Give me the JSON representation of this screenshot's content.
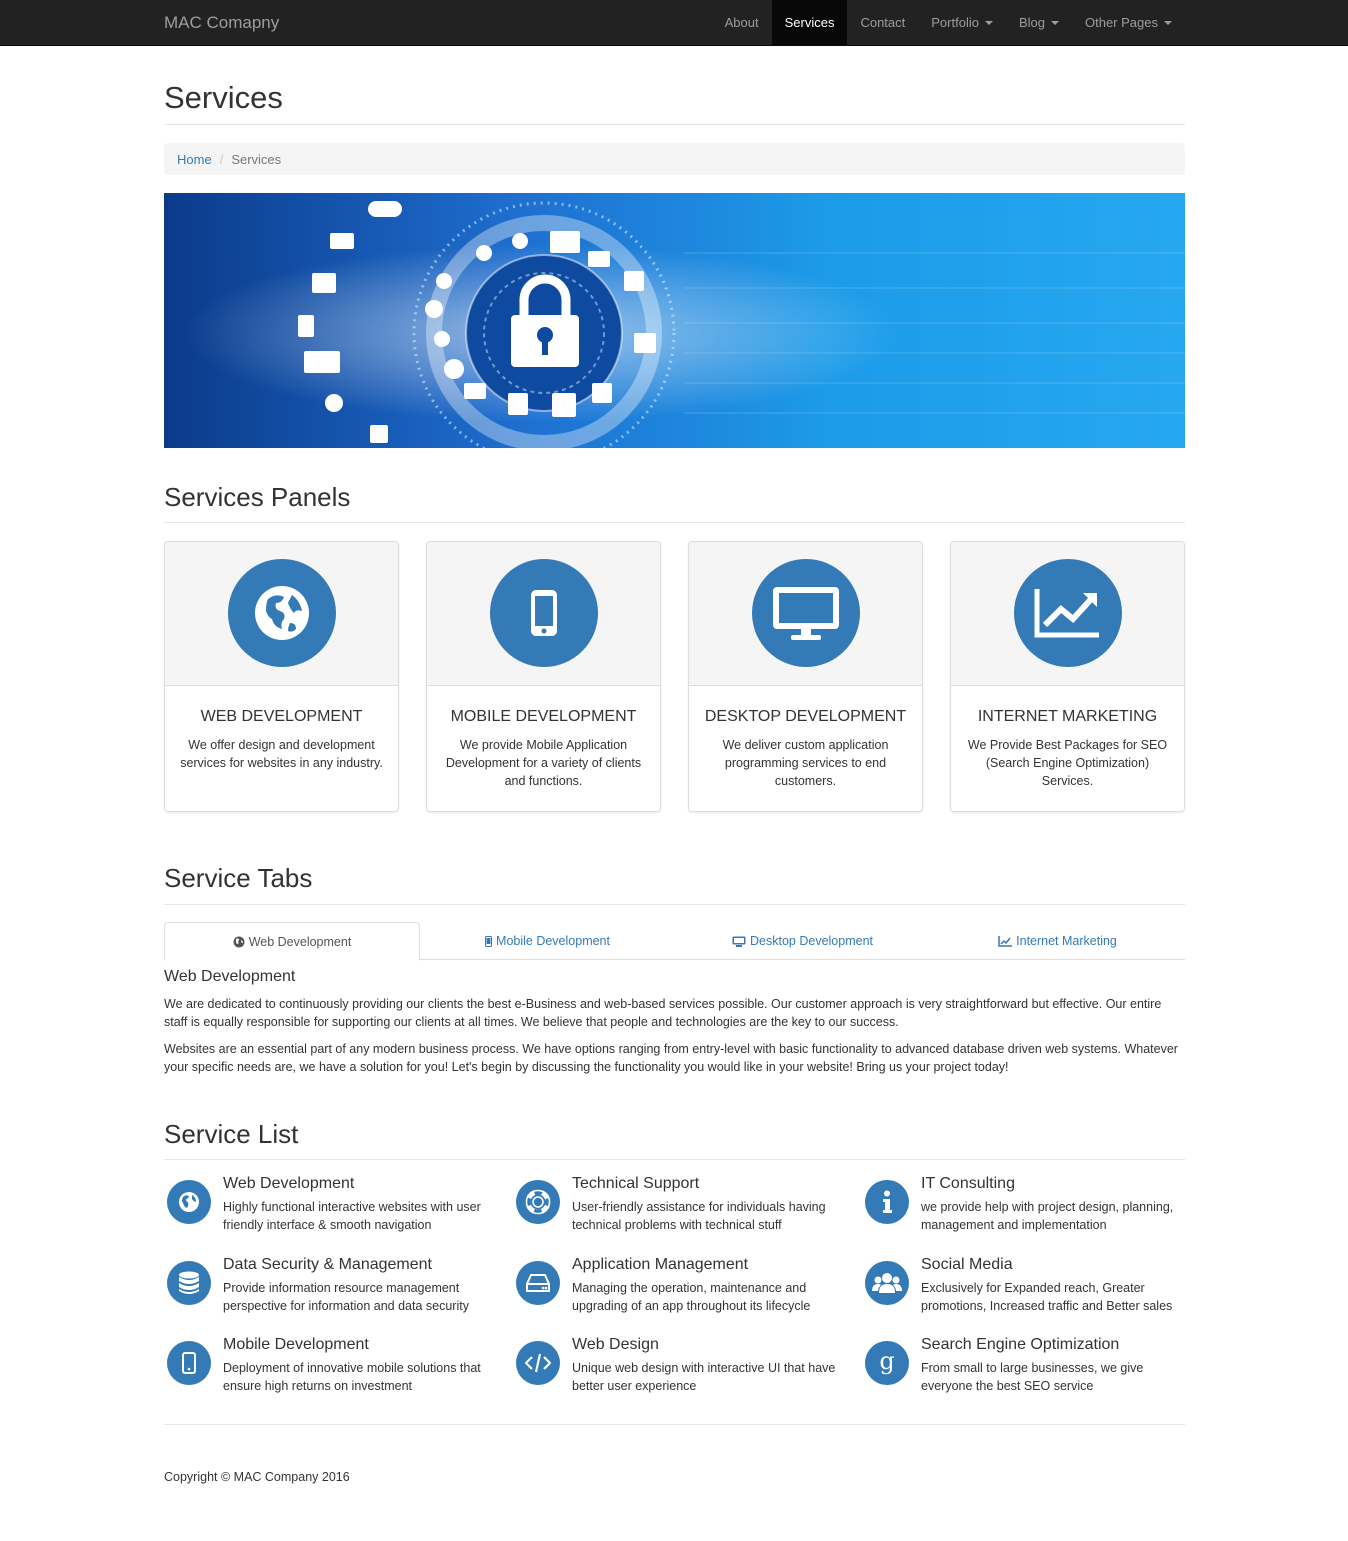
{
  "navbar": {
    "brand": "MAC Comapny",
    "items": [
      {
        "label": "About",
        "dropdown": false,
        "active": false
      },
      {
        "label": "Services",
        "dropdown": false,
        "active": true
      },
      {
        "label": "Contact",
        "dropdown": false,
        "active": false
      },
      {
        "label": "Portfolio",
        "dropdown": true,
        "active": false
      },
      {
        "label": "Blog",
        "dropdown": true,
        "active": false
      },
      {
        "label": "Other Pages",
        "dropdown": true,
        "active": false
      }
    ]
  },
  "page": {
    "title": "Services"
  },
  "breadcrumb": {
    "home": "Home",
    "current": "Services"
  },
  "panels_section": {
    "heading": "Services Panels",
    "panels": [
      {
        "icon": "globe-icon",
        "title": "WEB DEVELOPMENT",
        "text": "We offer design and development services for websites in any industry."
      },
      {
        "icon": "mobile-icon",
        "title": "MOBILE DEVELOPMENT",
        "text": "We provide Mobile Application Development for a variety of clients and functions."
      },
      {
        "icon": "desktop-icon",
        "title": "DESKTOP DEVELOPMENT",
        "text": "We deliver custom application programming services to end customers."
      },
      {
        "icon": "line-chart-icon",
        "title": "INTERNET MARKETING",
        "text": "We Provide Best Packages for SEO (Search Engine Optimization) Services."
      }
    ]
  },
  "tabs_section": {
    "heading": "Service Tabs",
    "tabs": [
      {
        "label": "Web Development",
        "icon": "globe-icon",
        "active": true
      },
      {
        "label": "Mobile Development",
        "icon": "mobile-icon",
        "active": false
      },
      {
        "label": "Desktop Development",
        "icon": "desktop-icon",
        "active": false
      },
      {
        "label": "Internet Marketing",
        "icon": "line-chart-icon",
        "active": false
      }
    ],
    "pane": {
      "title": "Web Development",
      "paragraphs": [
        "We are dedicated to continuously providing our clients the best e-Business and web-based services possible. Our customer approach is very straightforward but effective. Our entire staff is equally responsible for supporting our clients at all times. We believe that people and technologies are the key to our success.",
        "Websites are an essential part of any modern business process. We have options ranging from entry-level with basic functionality to advanced database driven web systems. Whatever your specific needs are, we have a solution for you! Let's begin by discussing the functionality you would like in your website! Bring us your project today!"
      ]
    }
  },
  "list_section": {
    "heading": "Service List",
    "items": [
      {
        "icon": "globe-icon",
        "title": "Web Development",
        "text": "Highly functional interactive websites with user friendly interface & smooth navigation"
      },
      {
        "icon": "life-ring-icon",
        "title": "Technical Support",
        "text": "User-friendly assistance for individuals having technical problems with technical stuff"
      },
      {
        "icon": "info-icon",
        "title": "IT Consulting",
        "text": "we provide help with project design, planning, management and implementation"
      },
      {
        "icon": "database-icon",
        "title": "Data Security & Management",
        "text": "Provide information resource management perspective for information and data security"
      },
      {
        "icon": "hdd-icon",
        "title": "Application Management",
        "text": "Managing the operation, maintenance and upgrading of an app throughout its lifecycle"
      },
      {
        "icon": "users-icon",
        "title": "Social Media",
        "text": "Exclusively for Expanded reach, Greater promotions, Increased traffic and Better sales"
      },
      {
        "icon": "mobile-icon",
        "title": "Mobile Development",
        "text": "Deployment of innovative mobile solutions that ensure high returns on investment"
      },
      {
        "icon": "code-icon",
        "title": "Web Design",
        "text": "Unique web design with interactive UI that have better user experience"
      },
      {
        "icon": "google-icon",
        "title": "Search Engine Optimization",
        "text": "From small to large businesses, we give everyone the best SEO service"
      }
    ]
  },
  "footer": {
    "copyright": "Copyright © MAC Company 2016"
  },
  "colors": {
    "accent": "#337ab7",
    "navbar": "#222222",
    "banner": "#1a8fe0"
  }
}
